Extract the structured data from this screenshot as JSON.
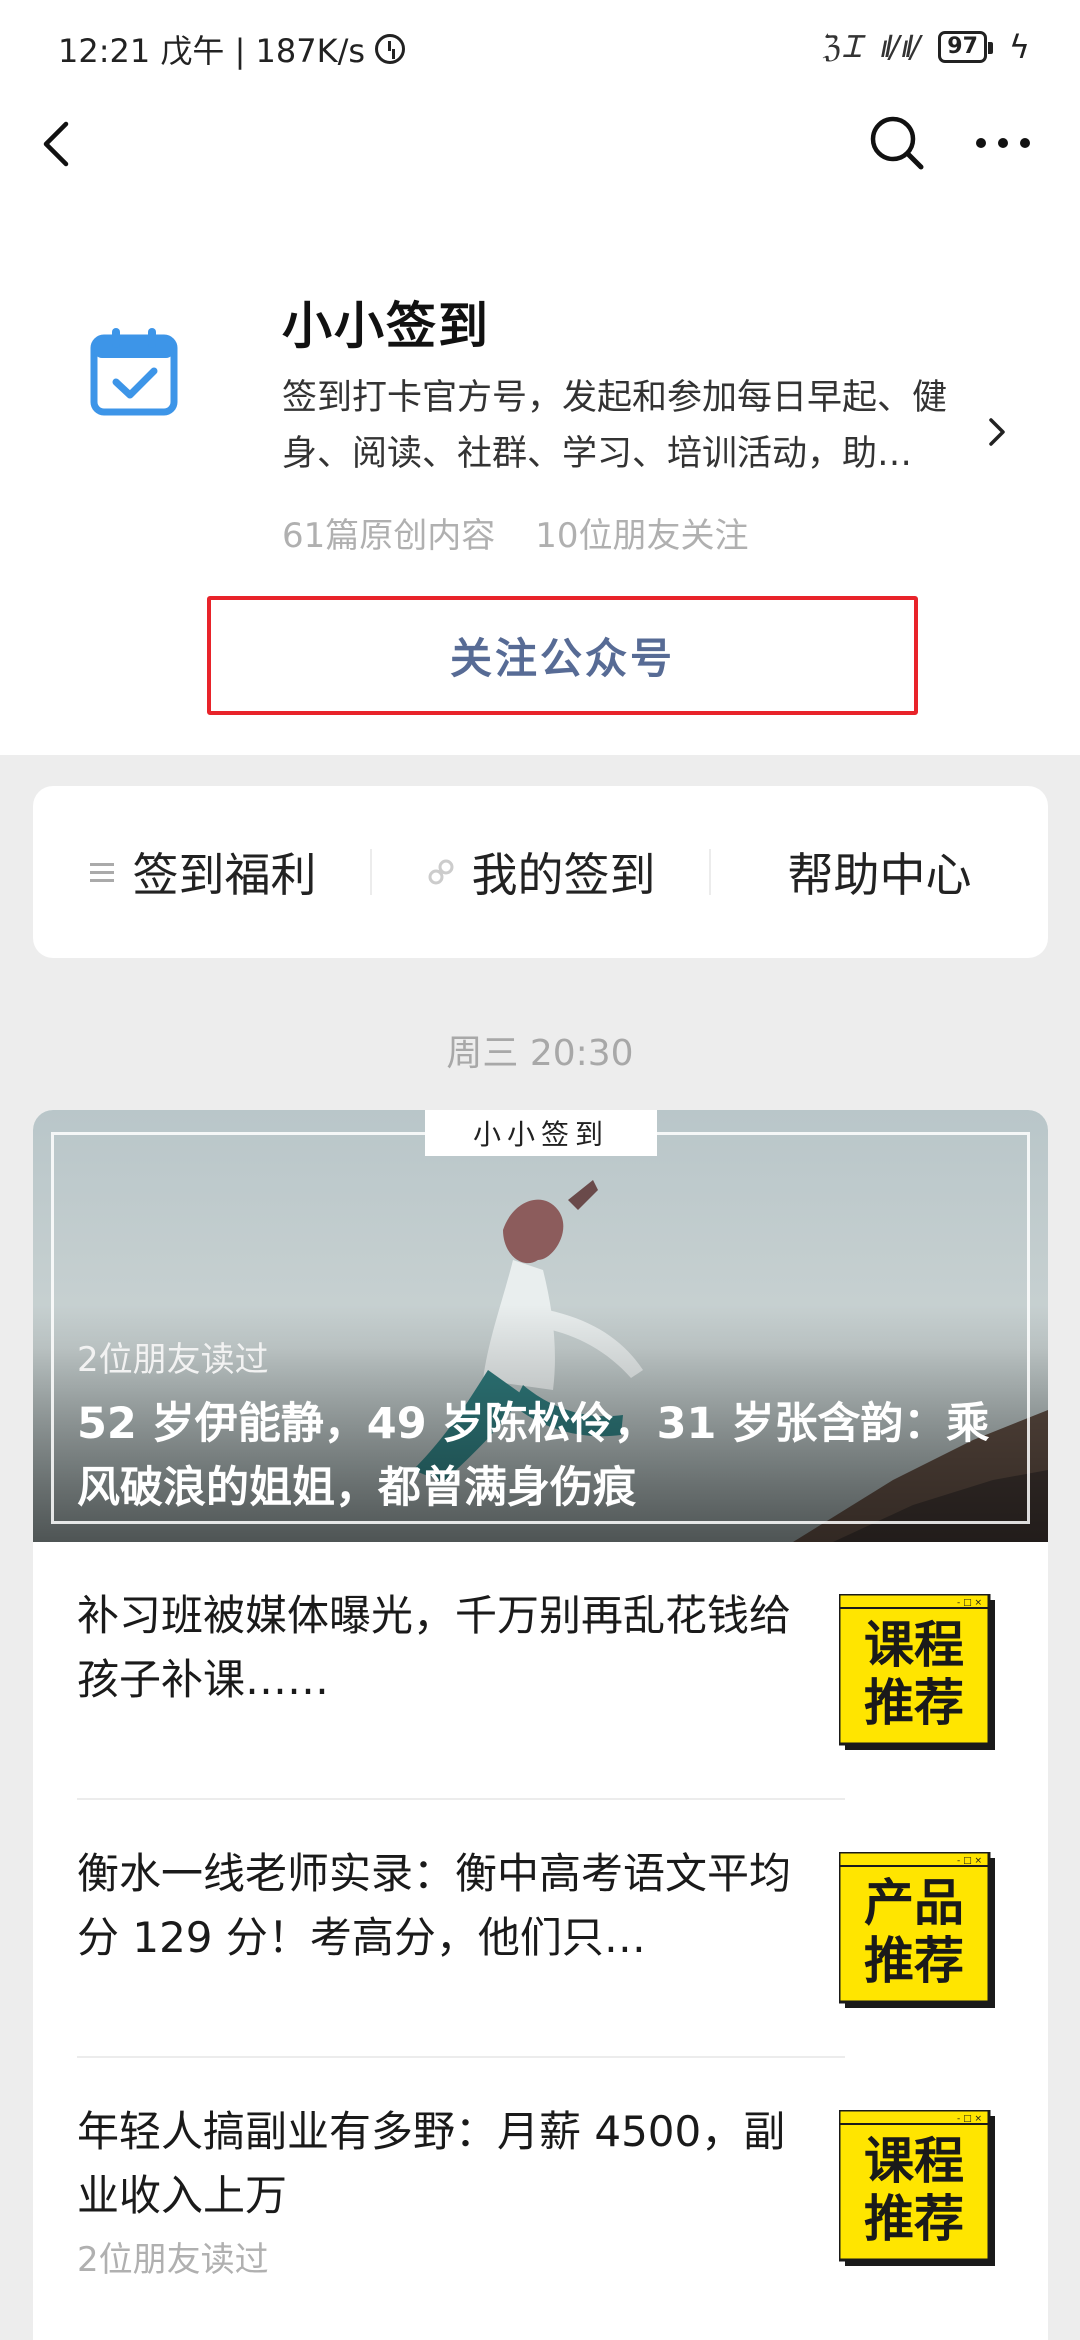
{
  "status_bar": {
    "time": "12:21 戊午 | 187K/s",
    "signal_text": "ℨ Ꮖ",
    "signal_bars": "ıI/ ıI/",
    "battery": "97",
    "bolt": "ϟ"
  },
  "account": {
    "name": "小小签到",
    "description": "签到打卡官方号，发起和参加每日早起、健身、阅读、社群、学习、培训活动，助…",
    "original_count": "61篇原创内容",
    "friends_following": "10位朋友关注",
    "follow_label": "关注公众号"
  },
  "menu": {
    "items": [
      {
        "label": "签到福利",
        "icon": "list-icon"
      },
      {
        "label": "我的签到",
        "icon": "link-icon"
      },
      {
        "label": "帮助中心",
        "icon": ""
      }
    ]
  },
  "timestamp": "周三 20:30",
  "hero_article": {
    "tag": "小小签到",
    "readers": "2位朋友读过",
    "title": "52 岁伊能静，49 岁陈松伶，31 岁张含韵：乘风破浪的姐姐，都曾满身伤痕"
  },
  "articles": [
    {
      "title": "补习班被媒体曝光，千万别再乱花钱给孩子补课……",
      "readers": "",
      "thumb_line1": "课程",
      "thumb_line2": "推荐"
    },
    {
      "title": "衡水一线老师实录：衡中高考语文平均分 129 分！考高分，他们只…",
      "readers": "",
      "thumb_line1": "产品",
      "thumb_line2": "推荐"
    },
    {
      "title": "年轻人搞副业有多野：月薪 4500，副业收入上万",
      "readers": "2位朋友读过",
      "thumb_line1": "课程",
      "thumb_line2": "推荐"
    }
  ],
  "colors": {
    "follow_border": "#e8232a",
    "follow_text": "#576b95",
    "thumb_yellow": "#ffe500",
    "calendar_blue": "#3d95e8"
  }
}
